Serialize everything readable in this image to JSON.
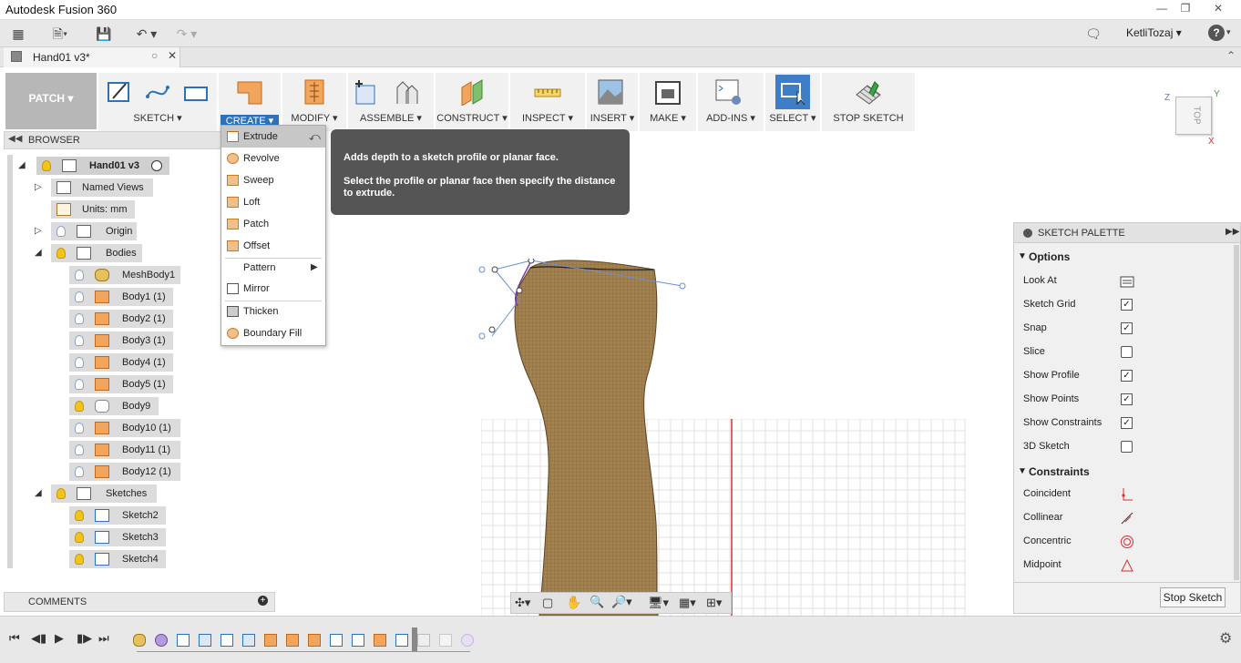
{
  "app": {
    "title": "Autodesk Fusion 360"
  },
  "header": {
    "user": "KetliTozaj ▾",
    "help": "?"
  },
  "document": {
    "tab_title": "Hand01 v3*"
  },
  "ribbon": {
    "workspace": "PATCH ▾",
    "groups": [
      {
        "label": "SKETCH ▾"
      },
      {
        "label": "CREATE ▾"
      },
      {
        "label": "MODIFY ▾"
      },
      {
        "label": "ASSEMBLE ▾"
      },
      {
        "label": "CONSTRUCT ▾"
      },
      {
        "label": "INSPECT ▾"
      },
      {
        "label": "INSERT ▾"
      },
      {
        "label": "MAKE ▾"
      },
      {
        "label": "ADD-INS ▾"
      },
      {
        "label": "SELECT ▾"
      },
      {
        "label": "STOP SKETCH"
      }
    ]
  },
  "create_menu": {
    "items": [
      "Extrude",
      "Revolve",
      "Sweep",
      "Loft",
      "Patch",
      "Offset",
      "Pattern",
      "Mirror",
      "Thicken",
      "Boundary Fill"
    ]
  },
  "tooltip": {
    "line1": "Adds depth to a sketch profile or planar face.",
    "line2": "Select the profile or planar face then specify the distance to extrude."
  },
  "browser": {
    "title": "BROWSER",
    "root": "Hand01 v3",
    "named_views": "Named Views",
    "units": "Units: mm",
    "origin": "Origin",
    "bodies": "Bodies",
    "body_items": [
      "MeshBody1",
      "Body1 (1)",
      "Body2 (1)",
      "Body3 (1)",
      "Body4 (1)",
      "Body5 (1)",
      "Body9",
      "Body10 (1)",
      "Body11 (1)",
      "Body12 (1)"
    ],
    "sketches": "Sketches",
    "sketch_items": [
      "Sketch2",
      "Sketch3",
      "Sketch4"
    ]
  },
  "comments": {
    "title": "COMMENTS"
  },
  "viewcube": {
    "face": "TOP",
    "axis_x": "X",
    "axis_y": "Y",
    "axis_z": "Z"
  },
  "sketch_palette": {
    "title": "SKETCH PALETTE",
    "options_header": "Options",
    "options": [
      {
        "label": "Look At",
        "kind": "icon"
      },
      {
        "label": "Sketch Grid",
        "checked": true
      },
      {
        "label": "Snap",
        "checked": true
      },
      {
        "label": "Slice",
        "checked": false
      },
      {
        "label": "Show Profile",
        "checked": true
      },
      {
        "label": "Show Points",
        "checked": true
      },
      {
        "label": "Show Constraints",
        "checked": true
      },
      {
        "label": "3D Sketch",
        "checked": false
      }
    ],
    "constraints_header": "Constraints",
    "constraints": [
      "Coincident",
      "Collinear",
      "Concentric",
      "Midpoint"
    ],
    "stop_button": "Stop Sketch"
  },
  "colors": {
    "accent": "#2d71b8",
    "body": "#a4824f",
    "axis_red": "#d93030"
  }
}
